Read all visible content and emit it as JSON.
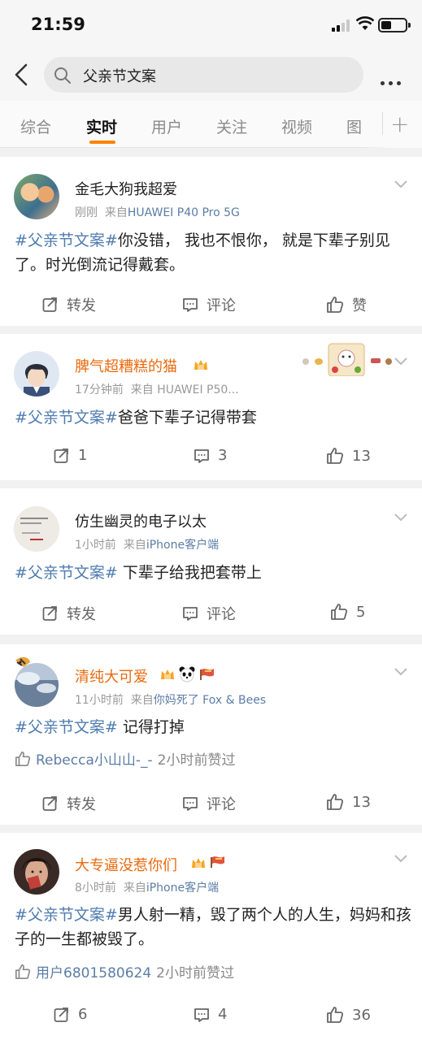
{
  "status_bar": {
    "time": "21:59"
  },
  "search": {
    "query": "父亲节文案"
  },
  "tabs": [
    {
      "label": "综合",
      "active": false
    },
    {
      "label": "实时",
      "active": true
    },
    {
      "label": "用户",
      "active": false
    },
    {
      "label": "关注",
      "active": false
    },
    {
      "label": "视频",
      "active": false
    },
    {
      "label": "图",
      "active": false
    }
  ],
  "accent_color": "#ff8200",
  "posts": [
    {
      "user": "金毛大狗我超爱",
      "time": "刚刚",
      "from_label": "来自",
      "source": "HUAWEI P40 Pro 5G",
      "tag": "#父亲节文案#",
      "text": "你没错， 我也不恨你， 就是下辈子别见了。时光倒流记得戴套。",
      "actions": {
        "repost": "转发",
        "comment": "评论",
        "like": "赞"
      }
    },
    {
      "user": "脾气超糟糕的猫",
      "time": "17分钟前",
      "from_label": "来自",
      "source": "HUAWEI P50...",
      "tag": "#父亲节文案#",
      "text": "爸爸下辈子记得带套",
      "actions": {
        "repost": "1",
        "comment": "3",
        "like": "13"
      }
    },
    {
      "user": "仿生幽灵的电子以太",
      "time": "1小时前",
      "from_label": "来自",
      "source": "iPhone客户端",
      "tag": "#父亲节文案#",
      "text": " 下辈子给我把套带上",
      "actions": {
        "repost": "转发",
        "comment": "评论",
        "like": "5"
      }
    },
    {
      "user": "清纯大可爱",
      "time": "11小时前",
      "from_label": "来自",
      "source": "你妈死了 Fox & Bees",
      "tag": "#父亲节文案#",
      "text": " 记得打掉",
      "liked_by": "Rebecca小山山-_-",
      "liked_when": "2小时前赞过",
      "actions": {
        "repost": "转发",
        "comment": "评论",
        "like": "13"
      }
    },
    {
      "user": "大专逼没惹你们",
      "time": "8小时前",
      "from_label": "来自",
      "source": "iPhone客户端",
      "tag": "#父亲节文案#",
      "text": "男人射一精，毁了两个人的人生，妈妈和孩子的一生都被毁了。",
      "liked_by": "用户6801580624",
      "liked_when": "2小时前赞过",
      "actions": {
        "repost": "6",
        "comment": "4",
        "like": "36"
      }
    }
  ]
}
